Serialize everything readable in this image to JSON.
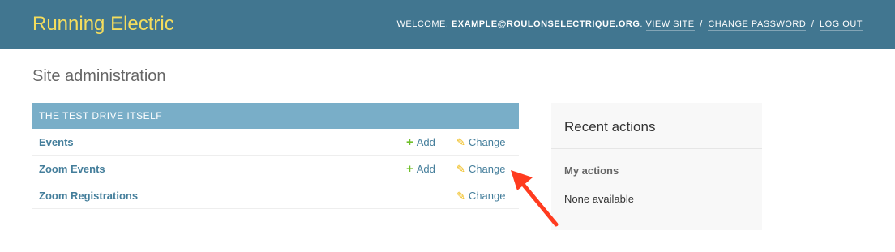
{
  "header": {
    "branding": "Running Electric",
    "welcome": "WELCOME,",
    "user_email": "EXAMPLE@ROULONSELECTRIQUE.ORG",
    "view_site": "VIEW SITE",
    "change_password": "CHANGE PASSWORD",
    "log_out": "LOG OUT",
    "separator": "/"
  },
  "page_title": "Site administration",
  "module": {
    "caption": "THE TEST DRIVE ITSELF",
    "rows": [
      {
        "name": "Events",
        "add": "Add",
        "change": "Change"
      },
      {
        "name": "Zoom Events",
        "add": "Add",
        "change": "Change"
      },
      {
        "name": "Zoom Registrations",
        "change": "Change"
      }
    ]
  },
  "recent_actions": {
    "title": "Recent actions",
    "subtitle": "My actions",
    "empty": "None available"
  },
  "colors": {
    "header_bg": "#417690",
    "branding": "#f5dd5d",
    "caption_bg": "#79aec8",
    "link": "#447e9b",
    "add_icon": "#70bf2b",
    "change_icon": "#efb80b",
    "arrow": "#ff3b1f"
  },
  "icons": {
    "add": "plus-icon",
    "change": "pencil-icon",
    "annotation": "red-arrow-icon"
  }
}
